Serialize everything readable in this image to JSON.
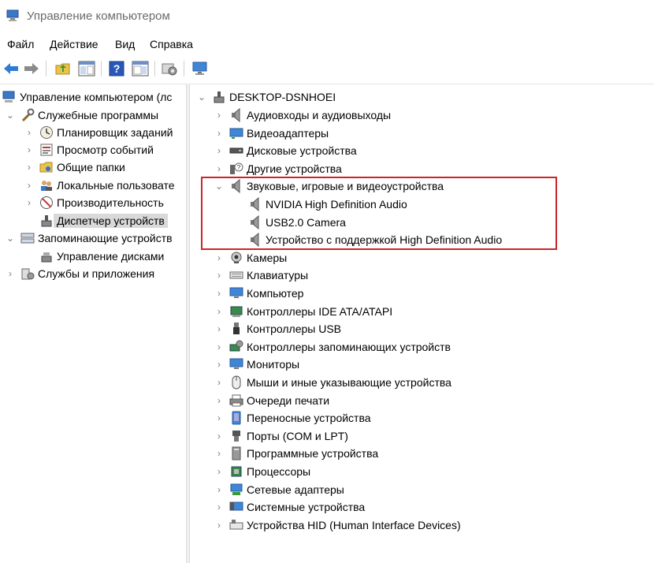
{
  "window": {
    "title": "Управление компьютером"
  },
  "menu": [
    "Файл",
    "Действие",
    "Вид",
    "Справка"
  ],
  "left_tree": [
    {
      "label": "Управление компьютером (лс",
      "icon": "computer-management-icon",
      "expander": "",
      "indent": 0
    },
    {
      "label": "Служебные программы",
      "icon": "tools-icon",
      "expander": "⌄",
      "indent": 1
    },
    {
      "label": "Планировщик заданий",
      "icon": "clock-icon",
      "expander": "›",
      "indent": 2
    },
    {
      "label": "Просмотр событий",
      "icon": "event-viewer-icon",
      "expander": "›",
      "indent": 2
    },
    {
      "label": "Общие папки",
      "icon": "shared-folder-icon",
      "expander": "›",
      "indent": 2
    },
    {
      "label": "Локальные пользовате",
      "icon": "users-icon",
      "expander": "›",
      "indent": 2
    },
    {
      "label": "Производительность",
      "icon": "performance-icon",
      "expander": "›",
      "indent": 2
    },
    {
      "label": "Диспетчер устройств",
      "icon": "device-manager-icon",
      "expander": "",
      "indent": 2,
      "selected": true
    },
    {
      "label": "Запоминающие устройств",
      "icon": "storage-icon",
      "expander": "⌄",
      "indent": 1
    },
    {
      "label": "Управление дисками",
      "icon": "disk-management-icon",
      "expander": "",
      "indent": 2
    },
    {
      "label": "Службы и приложения",
      "icon": "services-icon",
      "expander": "›",
      "indent": 1
    }
  ],
  "device_tree": {
    "root": "DESKTOP-DSNHOEI",
    "categories": [
      {
        "label": "Аудиовходы и аудиовыходы",
        "icon": "speaker-icon",
        "expander": "›"
      },
      {
        "label": "Видеоадаптеры",
        "icon": "display-adapter-icon",
        "expander": "›"
      },
      {
        "label": "Дисковые устройства",
        "icon": "disk-drive-icon",
        "expander": "›"
      },
      {
        "label": "Другие устройства",
        "icon": "unknown-device-icon",
        "expander": "›"
      },
      {
        "label": "Звуковые, игровые и видеоустройства",
        "icon": "speaker-icon",
        "expander": "⌄",
        "children": [
          {
            "label": "NVIDIA High Definition Audio",
            "icon": "speaker-icon"
          },
          {
            "label": "USB2.0 Camera",
            "icon": "speaker-icon"
          },
          {
            "label": "Устройство с поддержкой High Definition Audio",
            "icon": "speaker-icon"
          }
        ]
      },
      {
        "label": "Камеры",
        "icon": "camera-icon",
        "expander": "›"
      },
      {
        "label": "Клавиатуры",
        "icon": "keyboard-icon",
        "expander": "›"
      },
      {
        "label": "Компьютер",
        "icon": "monitor-icon",
        "expander": "›"
      },
      {
        "label": "Контроллеры IDE ATA/ATAPI",
        "icon": "ide-controller-icon",
        "expander": "›"
      },
      {
        "label": "Контроллеры USB",
        "icon": "usb-icon",
        "expander": "›"
      },
      {
        "label": "Контроллеры запоминающих устройств",
        "icon": "storage-controller-icon",
        "expander": "›"
      },
      {
        "label": "Мониторы",
        "icon": "monitor-icon",
        "expander": "›"
      },
      {
        "label": "Мыши и иные указывающие устройства",
        "icon": "mouse-icon",
        "expander": "›"
      },
      {
        "label": "Очереди печати",
        "icon": "printer-icon",
        "expander": "›"
      },
      {
        "label": "Переносные устройства",
        "icon": "portable-device-icon",
        "expander": "›"
      },
      {
        "label": "Порты (COM и LPT)",
        "icon": "port-icon",
        "expander": "›"
      },
      {
        "label": "Программные устройства",
        "icon": "software-device-icon",
        "expander": "›"
      },
      {
        "label": "Процессоры",
        "icon": "processor-icon",
        "expander": "›"
      },
      {
        "label": "Сетевые адаптеры",
        "icon": "network-adapter-icon",
        "expander": "›"
      },
      {
        "label": "Системные устройства",
        "icon": "system-device-icon",
        "expander": "›"
      },
      {
        "label": "Устройства HID (Human Interface Devices)",
        "icon": "hid-icon",
        "expander": "›"
      }
    ]
  },
  "colors": {
    "highlight_box": "#c9262b",
    "selected_bg": "#d9d9d9"
  }
}
